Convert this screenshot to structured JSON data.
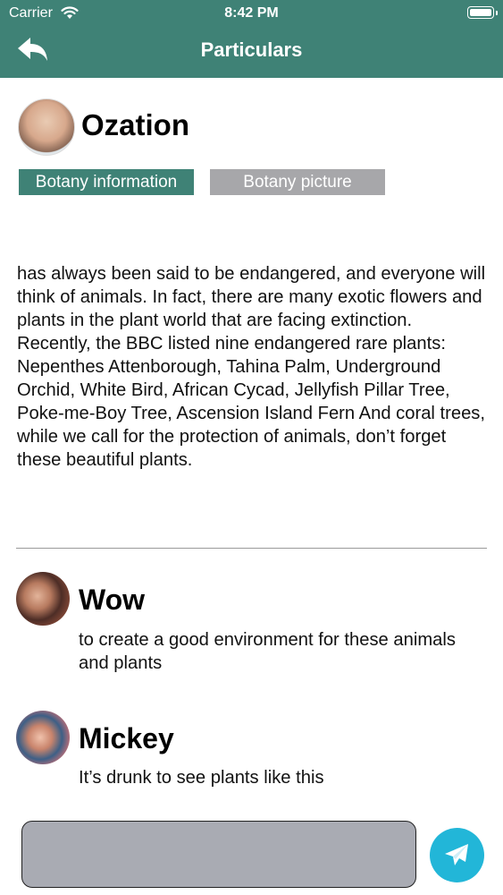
{
  "status_bar": {
    "carrier": "Carrier",
    "time": "8:42 PM"
  },
  "nav": {
    "title": "Particulars",
    "back_icon": "back-arrow-icon"
  },
  "post": {
    "author": "Ozation",
    "tabs": [
      {
        "label": "Botany information",
        "selected": true
      },
      {
        "label": "Botany picture",
        "selected": false
      }
    ],
    "body": "has always been said to be endangered, and everyone will think of animals. In fact, there are many exotic flowers and plants in the plant world that are facing extinction. Recently, the BBC listed nine endangered rare plants: Nepenthes Attenborough, Tahina Palm, Underground Orchid, White Bird, African Cycad, Jellyfish Pillar Tree, Poke-me-Boy Tree, Ascension Island Fern And coral trees, while we call for the protection of animals, don’t forget these beautiful plants."
  },
  "comments": [
    {
      "name": "Wow",
      "text": "to create a good environment for these animals and plants"
    },
    {
      "name": "Mickey",
      "text": "It’s drunk to see plants like this"
    }
  ],
  "composer": {
    "input_value": "",
    "send_icon": "paper-plane-icon"
  },
  "colors": {
    "header": "#3f8276",
    "tab_selected": "#3f8276",
    "tab_unselected": "#a7a7aa",
    "send_button": "#22b6d8",
    "input_bg": "#a9abb3"
  }
}
